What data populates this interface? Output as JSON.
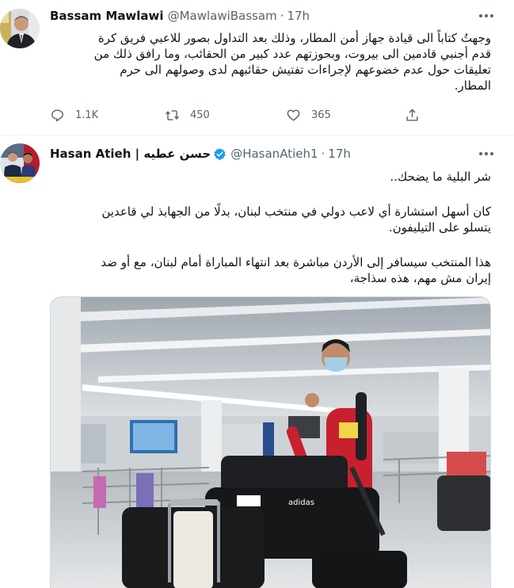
{
  "tweets": [
    {
      "author_name": "Bassam Mawlawi",
      "handle": "@MawlawiBassam",
      "separator": "·",
      "time": "17h",
      "text_lines": [
        "وجهتُ كتاباً الى قيادة جهاز أمن المطار، وذلك بعد التداول بصور للاعبي فريق كرة",
        "قدم أجنبي قادمين الى بيروت، وبحوزتهم عدد كبير من الحقائب، وما رافق ذلك من",
        "تعليقات حول عدم خضوعهم لإجراءات تفتيش حقائبهم لدى وصولهم الى حرم",
        "المطار."
      ],
      "actions": {
        "reply_count": "1.1K",
        "retweet_count": "450",
        "like_count": "365"
      }
    },
    {
      "author_name": "Hasan Atieh | حسن عطيه",
      "verified": true,
      "handle": "@HasanAtieh1",
      "separator": "·",
      "time": "17h",
      "paragraph1": "شر البلية ما يضحك..",
      "paragraph2_lines": [
        "كان أسهل استشارة أي لاعب دولي في منتخب لبنان، بدلًا من الجهابذ لي قاعدين",
        "يتسلو على التيليفون."
      ],
      "paragraph3_lines": [
        "هذا المنتخب سيسافر إلى الأردن مباشرة بعد انتهاء المباراة أمام لبنان، مع أو ضد",
        "إيران مش مهم، هذه سذاجة،"
      ]
    }
  ],
  "icons": {
    "more": "more-icon",
    "reply": "reply-icon",
    "retweet": "retweet-icon",
    "like": "like-icon",
    "share": "share-icon",
    "verified": "verified-badge-icon"
  },
  "colors": {
    "text_primary": "#0f1419",
    "text_secondary": "#536471",
    "verified_blue": "#1d9bf0",
    "divider": "#eff3f4"
  }
}
